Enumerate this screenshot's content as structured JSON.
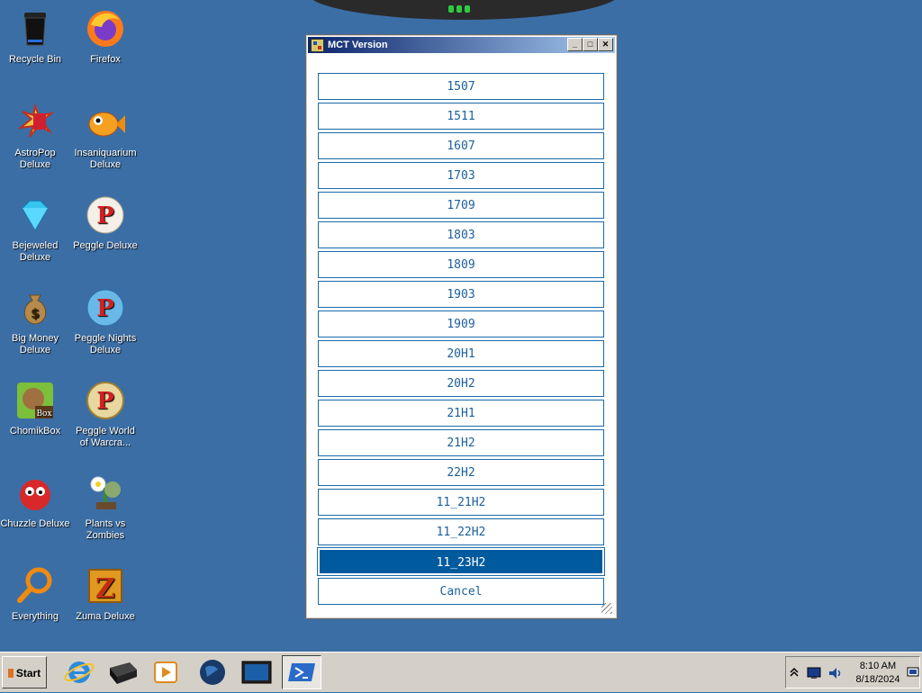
{
  "desktop": {
    "icons": [
      {
        "label": "Recycle Bin",
        "icon": "recycle-bin-icon"
      },
      {
        "label": "Firefox",
        "icon": "firefox-icon"
      },
      {
        "label": "AstroPop Deluxe",
        "icon": "astropop-icon"
      },
      {
        "label": "Insaniquarium Deluxe",
        "icon": "insaniquarium-icon"
      },
      {
        "label": "Bejeweled Deluxe",
        "icon": "bejeweled-icon"
      },
      {
        "label": "Peggle Deluxe",
        "icon": "peggle-icon"
      },
      {
        "label": "Big Money Deluxe",
        "icon": "big-money-icon"
      },
      {
        "label": "Peggle Nights Deluxe",
        "icon": "peggle-nights-icon"
      },
      {
        "label": "ChomikBox",
        "icon": "chomikbox-icon"
      },
      {
        "label": "Peggle World of Warcra...",
        "icon": "peggle-wow-icon"
      },
      {
        "label": "Chuzzle Deluxe",
        "icon": "chuzzle-icon"
      },
      {
        "label": "Plants vs Zombies",
        "icon": "plants-vs-zombies-icon"
      },
      {
        "label": "Everything",
        "icon": "everything-search-icon"
      },
      {
        "label": "Zuma Deluxe",
        "icon": "zuma-icon"
      }
    ]
  },
  "window": {
    "title": "MCT Version",
    "controls": {
      "minimize": "_",
      "maximize": "□",
      "close": "✕"
    },
    "options": [
      "1507",
      "1511",
      "1607",
      "1703",
      "1709",
      "1803",
      "1809",
      "1903",
      "1909",
      "20H1",
      "20H2",
      "21H1",
      "21H2",
      "22H2",
      "11_21H2",
      "11_22H2",
      "11_23H2"
    ],
    "selected": "11_23H2",
    "cancel_label": "Cancel"
  },
  "taskbar": {
    "start_label": "Start",
    "apps": [
      "internet-explorer-icon",
      "drive-icon",
      "media-player-icon",
      "globe-icon",
      "remote-desktop-icon",
      "powershell-icon"
    ],
    "active_app": "powershell-icon",
    "tray_icons": [
      "show-hidden-icons-chevron",
      "network-icon",
      "volume-icon",
      "notification-icon"
    ],
    "time": "8:10 AM",
    "date": "8/18/2024"
  },
  "colors": {
    "desktop_bg": "#3b6ea5",
    "button_border": "#1a6aa8",
    "button_text": "#1a5f9c",
    "selected_bg": "#005a9e"
  }
}
